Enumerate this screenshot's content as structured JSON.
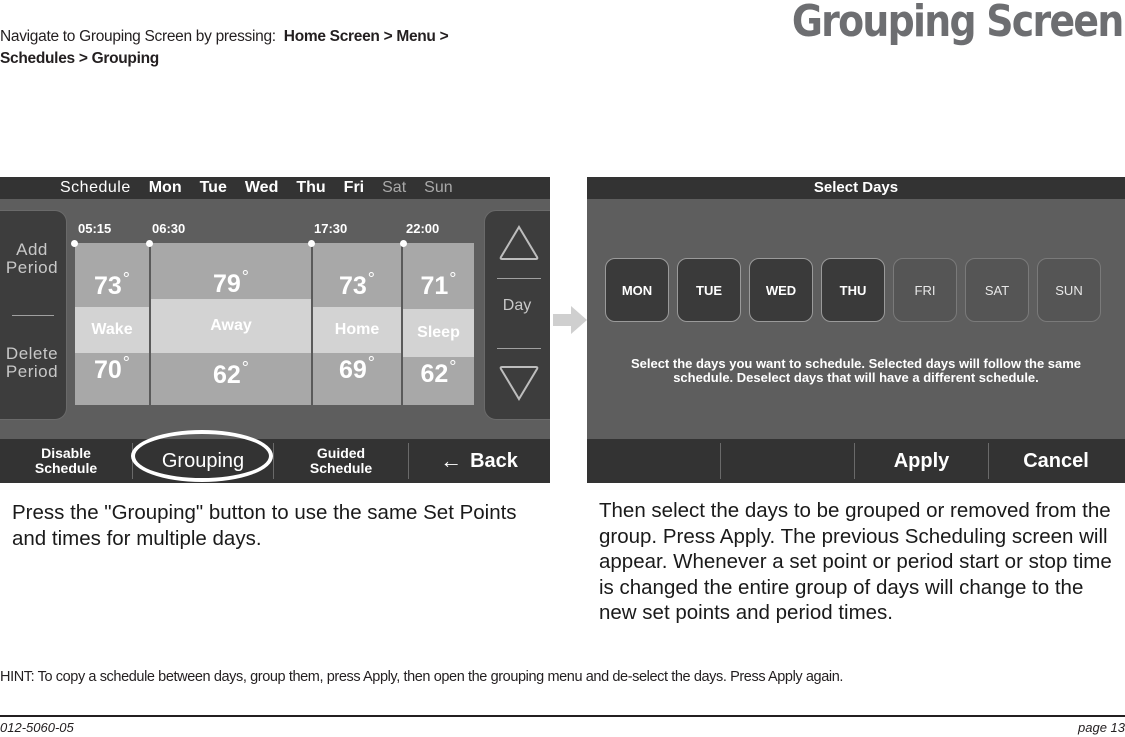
{
  "header": {
    "nav_intro": "Navigate to Grouping Screen by pressing:",
    "nav_path_line1": "Home Screen > Menu >",
    "nav_path_line2": "Schedules > Grouping",
    "title": "Grouping Screen"
  },
  "schedule_screen": {
    "title": "Schedule",
    "days": [
      {
        "label": "Mon",
        "active": true
      },
      {
        "label": "Tue",
        "active": true
      },
      {
        "label": "Wed",
        "active": true
      },
      {
        "label": "Thu",
        "active": true
      },
      {
        "label": "Fri",
        "active": true
      },
      {
        "label": "Sat",
        "active": false
      },
      {
        "label": "Sun",
        "active": false
      }
    ],
    "add_period_line1": "Add",
    "add_period_line2": "Period",
    "delete_period_line1": "Delete",
    "delete_period_line2": "Period",
    "day_label": "Day",
    "periods": [
      {
        "start": "05:15",
        "name": "Wake",
        "cool": "73",
        "heat": "70"
      },
      {
        "start": "06:30",
        "name": "Away",
        "cool": "79",
        "heat": "62"
      },
      {
        "start": "17:30",
        "name": "Home",
        "cool": "73",
        "heat": "69"
      },
      {
        "start": "22:00",
        "name": "Sleep",
        "cool": "71",
        "heat": "62"
      }
    ],
    "degree_symbol": "°",
    "bottom": {
      "disable_line1": "Disable",
      "disable_line2": "Schedule",
      "grouping": "Grouping",
      "guided_line1": "Guided",
      "guided_line2": "Schedule",
      "back": "Back",
      "back_icon": "←"
    }
  },
  "select_days_screen": {
    "title": "Select Days",
    "days": [
      {
        "label": "MON",
        "selected": true
      },
      {
        "label": "TUE",
        "selected": true
      },
      {
        "label": "WED",
        "selected": true
      },
      {
        "label": "THU",
        "selected": true
      },
      {
        "label": "FRI",
        "selected": false
      },
      {
        "label": "SAT",
        "selected": false
      },
      {
        "label": "SUN",
        "selected": false
      }
    ],
    "instructions_line1": "Select the days you want to schedule.  Selected days will follow the same",
    "instructions_line2": "schedule.  Deselect days that will have a different schedule.",
    "apply": "Apply",
    "cancel": "Cancel"
  },
  "captions": {
    "left": "Press the \"Grouping\" button to use the same Set Points and times for multiple days.",
    "right": "Then select the days to be grouped or removed from the group. Press Apply.  The previous Scheduling screen will appear. Whenever a set point or period start or stop time is changed the entire group of days will change to the new set points and period times."
  },
  "hint": "HINT: To copy a schedule between days, group them, press Apply, then open the grouping menu and de-select the days.  Press Apply again.",
  "footer": {
    "doc_number": "012-5060-05",
    "page": "page 13"
  },
  "colors": {
    "title_gray": "#6d6e71",
    "screen_bg": "#5e5e5e",
    "bar_dark": "#333333",
    "period_band": "#d3d3d3",
    "period_fill": "#a8a8a8"
  }
}
